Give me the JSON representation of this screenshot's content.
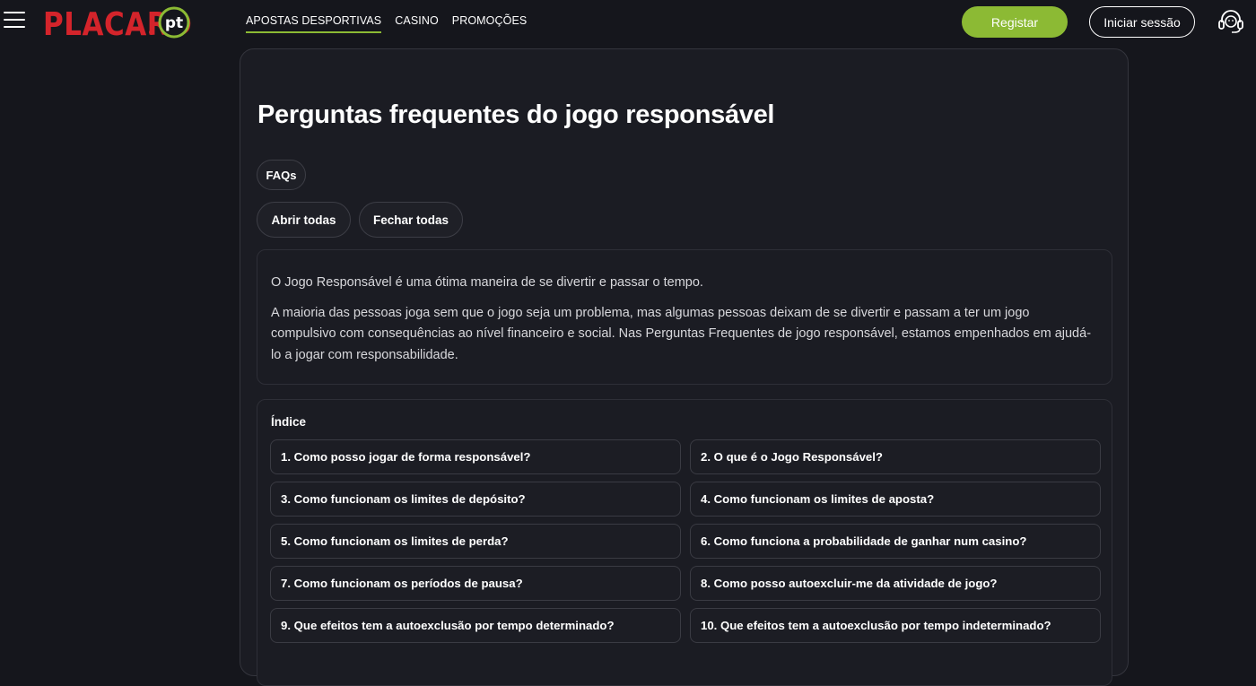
{
  "header": {
    "logo_text": "PLACARD",
    "logo_suffix": "pt",
    "nav": [
      {
        "label": "APOSTAS DESPORTIVAS",
        "active": true
      },
      {
        "label": "CASINO",
        "active": false
      },
      {
        "label": "PROMOÇÕES",
        "active": false
      }
    ],
    "register_label": "Registar",
    "login_label": "Iniciar sessão",
    "icons": {
      "menu": "hamburger-menu-icon",
      "support": "headset-support-icon"
    }
  },
  "colors": {
    "accent": "#8cba34",
    "brand_red": "#d4242b",
    "background": "#15161c",
    "card": "#1b1c23"
  },
  "page": {
    "title": "Perguntas frequentes do jogo responsável",
    "faq_chip": "FAQs",
    "open_all": "Abrir todas",
    "close_all": "Fechar todas",
    "intro": [
      "O Jogo Responsável é uma ótima maneira de se divertir e passar o tempo.",
      "A maioria das pessoas joga sem que o jogo seja um problema, mas algumas pessoas deixam de se divertir e passam a ter um jogo compulsivo com consequências ao nível financeiro e social. Nas Perguntas Frequentes de jogo responsável, estamos empenhados em ajudá-lo a jogar com responsabilidade."
    ],
    "index_title": "Índice",
    "questions": [
      "1. Como posso jogar de forma responsável?",
      "2. O que é o Jogo Responsável?",
      "3. Como funcionam os limites de depósito?",
      "4. Como funcionam os limites de aposta?",
      "5. Como funcionam os limites de perda?",
      "6. Como funciona a probabilidade de ganhar num casino?",
      "7. Como funcionam os períodos de pausa?",
      "8. Como posso autoexcluir-me da atividade de jogo?",
      "9. Que efeitos tem a autoexclusão por tempo determinado?",
      "10. Que efeitos tem a autoexclusão por tempo indeterminado?"
    ]
  }
}
